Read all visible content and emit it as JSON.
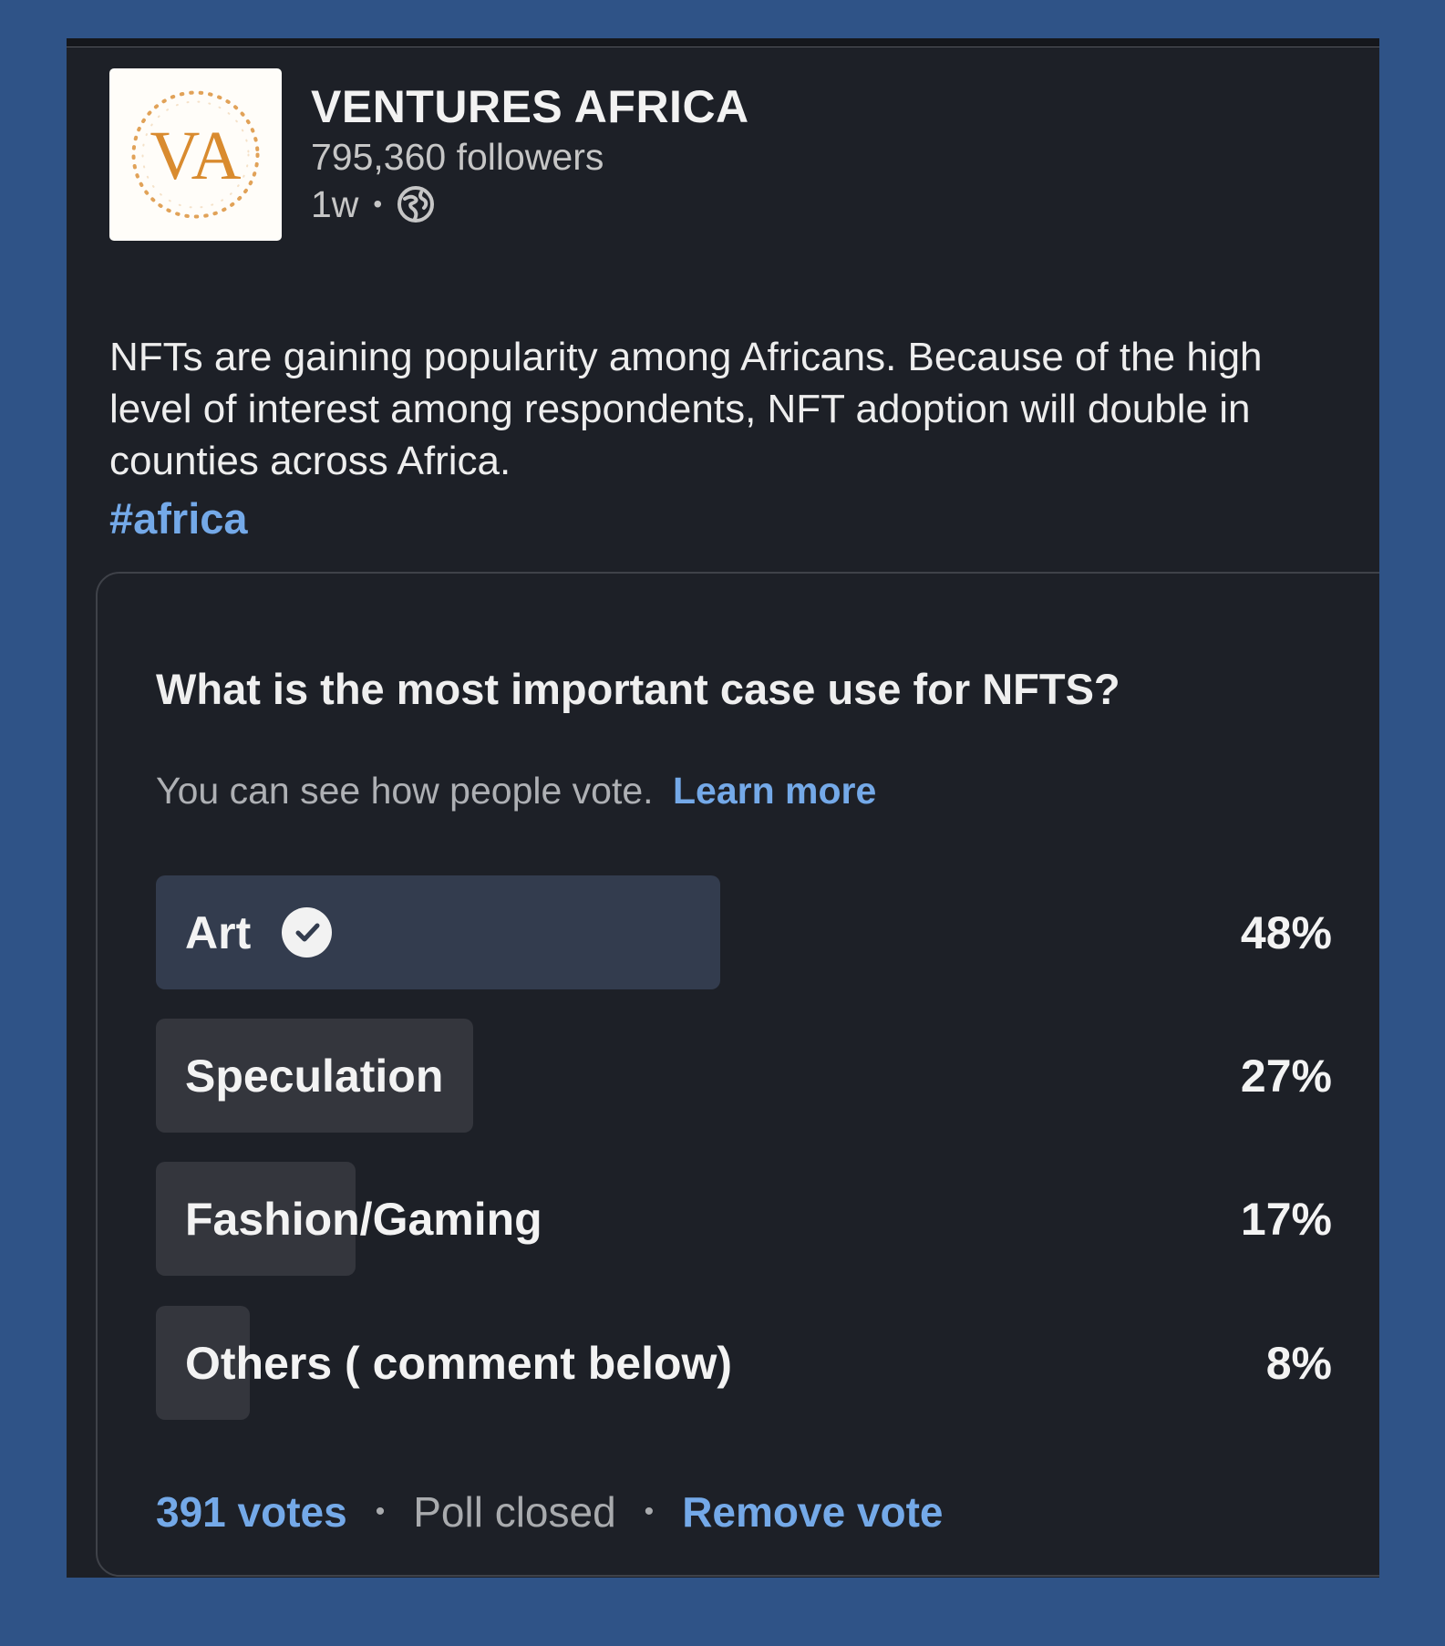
{
  "colors": {
    "page_background": "#2f5387",
    "card_background": "#1d2027",
    "link_blue": "#74a9e8",
    "logo_orange": "#d98b2f",
    "selected_option": "#333c4e",
    "option_bar": "#34363d"
  },
  "post": {
    "author": {
      "logo_text": "VA",
      "name": "VENTURES AFRICA",
      "followers": "795,360 followers",
      "posted_ago": "1w",
      "separator": "•",
      "visibility_icon": "globe-icon"
    },
    "body": "NFTs are gaining popularity among Africans. Because of the high level of interest among respondents, NFT adoption will double in counties across Africa.",
    "hashtag": "#africa"
  },
  "poll": {
    "question": "What is the most important case use for NFTS?",
    "visibility_note": "You can see how people vote.",
    "learn_more": "Learn more",
    "options": [
      {
        "label": "Art",
        "percent_text": "48%",
        "percent": 48,
        "selected": true,
        "selected_icon": "check-circle-icon"
      },
      {
        "label": "Speculation",
        "percent_text": "27%",
        "percent": 27,
        "selected": false
      },
      {
        "label": "Fashion/Gaming",
        "percent_text": "17%",
        "percent": 17,
        "selected": false
      },
      {
        "label": "Others ( comment below)",
        "percent_text": "8%",
        "percent": 8,
        "selected": false
      }
    ],
    "footer": {
      "votes": "391 votes",
      "separator": "•",
      "status": "Poll closed",
      "remove_vote": "Remove vote"
    }
  }
}
